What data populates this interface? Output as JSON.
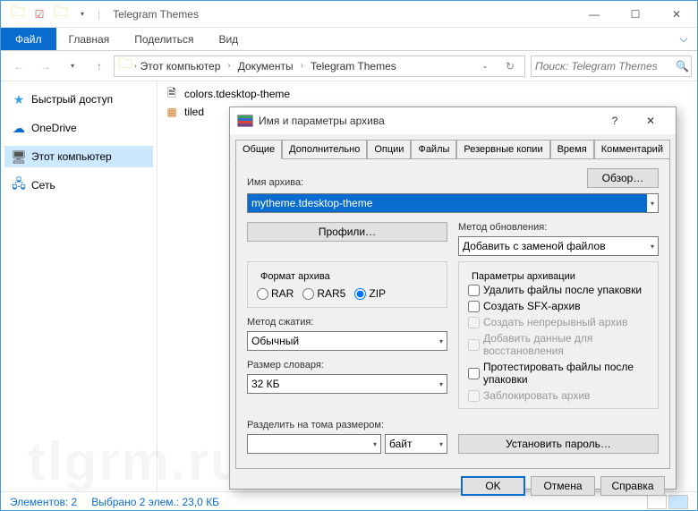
{
  "window": {
    "title": "Telegram Themes",
    "min": "—",
    "max": "☐",
    "close": "✕"
  },
  "ribbon": {
    "file": "Файл",
    "home": "Главная",
    "share": "Поделиться",
    "view": "Вид"
  },
  "breadcrumb": {
    "pc": "Этот компьютер",
    "docs": "Документы",
    "folder": "Telegram Themes"
  },
  "search_placeholder": "Поиск: Telegram Themes",
  "sidebar": {
    "quick": "Быстрый доступ",
    "onedrive": "OneDrive",
    "pc": "Этот компьютер",
    "network": "Сеть"
  },
  "files": {
    "f1": "colors.tdesktop-theme",
    "f2": "tiled"
  },
  "status": {
    "items": "Элементов: 2",
    "selected": "Выбрано 2 элем.: 23,0 КБ"
  },
  "dialog": {
    "title": "Имя и параметры архива",
    "help": "?",
    "close": "✕",
    "tabs": {
      "t0": "Общие",
      "t1": "Дополнительно",
      "t2": "Опции",
      "t3": "Файлы",
      "t4": "Резервные копии",
      "t5": "Время",
      "t6": "Комментарий"
    },
    "name_lbl": "Имя архива:",
    "name_val": "mytheme.tdesktop-theme",
    "browse": "Обзор…",
    "profiles": "Профили…",
    "update_lbl": "Метод обновления:",
    "update_val": "Добавить с заменой файлов",
    "format_lbl": "Формат архива",
    "r_rar": "RAR",
    "r_rar5": "RAR5",
    "r_zip": "ZIP",
    "compress_lbl": "Метод сжатия:",
    "compress_val": "Обычный",
    "dict_lbl": "Размер словаря:",
    "dict_val": "32 КБ",
    "split_lbl": "Разделить на тома размером:",
    "split_unit": "байт",
    "params_lbl": "Параметры архивации",
    "c1": "Удалить файлы после упаковки",
    "c2": "Создать SFX-архив",
    "c3": "Создать непрерывный архив",
    "c4": "Добавить данные для восстановления",
    "c5": "Протестировать файлы после упаковки",
    "c6": "Заблокировать архив",
    "password": "Установить пароль…",
    "ok": "OK",
    "cancel": "Отмена",
    "help_btn": "Справка"
  }
}
